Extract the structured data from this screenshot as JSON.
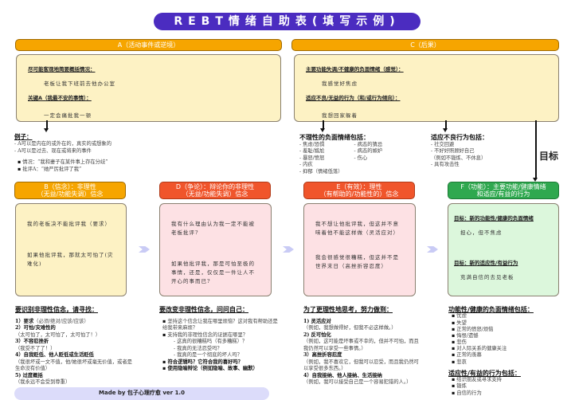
{
  "title": "REBT情绪自助表(填写示例)",
  "a": {
    "header": "A（活动事件或逆境）",
    "label1": "尽可能客观地简要概括情况：",
    "text1": "老板让我下班前去他办公室",
    "label2": "关键A（我最不安的事情）：",
    "text2": "一定会痛批我一顿",
    "example_title": "例子：",
    "example_lines": [
      "- A可以是内在的或外在的，真实的或想象的",
      "- A可以是过去、现在或将来的事件"
    ],
    "bullets": [
      "情况：“我和妻子在某件事上存在分歧”",
      "批评A：“她严厉批评了我”"
    ]
  },
  "c": {
    "header": "C（后果）",
    "label1": "主要功能失调/不健康的负面情绪（感觉）：",
    "text1": "我感觉好焦虑",
    "label2": "适应不良/无益的行为（和/或行为倾向）：",
    "text2": "我想回家躲着",
    "emotions_title": "不理性的负面情绪包括：",
    "emotions_col1": [
      "- 焦虑/恐惧",
      "- 羞耻/尴尬",
      "- 暴怒/愤怒",
      "- 内疚",
      "- 抑郁（情绪低落）"
    ],
    "emotions_col2": [
      "- 病态的猜忌",
      "- 病态的嫉妒",
      "- 伤心"
    ],
    "behaviors_title": "适应不良行为包括：",
    "behaviors": [
      "- 社交回避",
      "- 不好好照顾好自己",
      "（例如不锻炼、不休息）",
      "- 具有攻击性"
    ],
    "goal": "目标"
  },
  "b": {
    "header_line1": "B（信念）：非理性",
    "header_line2": "（无益/功能失调）信念",
    "text1": "我的老板决不能批评我（要求）",
    "text2": "如果他批评我，那就太可怕了(灾难化)",
    "guide_title": "要识别非理性信念，请寻找：",
    "guide": [
      {
        "t": "1）要求",
        "d": "（必须/绝对/应该/应该）"
      },
      {
        "t": "2）可怕/灾难性的",
        "d": "（太可怕了，太可怕了，太可怕了！）"
      },
      {
        "t": "3）不容忍挫折",
        "d": "（我受不了了！）"
      },
      {
        "t": "4）自我贬低、他人贬低或生活贬低",
        "d": "（我很坏或一文不值，他/她很坏或毫无价值，或者是生命没有价值）"
      },
      {
        "t": "5) 过度概括",
        "d": "（我永远不会受到尊重）"
      }
    ]
  },
  "d": {
    "header_line1": "D（争论）：辩论你的非理性",
    "header_line2": "（无益/功能失调）信念",
    "text1": "我有什么理由认为我一定不能被老板批评?",
    "text2": "如果他批评我，那是可怕至极的事情，还是，仅仅是一件让人不开心的事而已?",
    "guide_title": "要改变非理性信念，问问自己：",
    "guide": [
      "坚持这个信念让我在哪里烦恼？这对我有帮助还是给我带来麻烦？",
      "支持我的非理性信念的证据在哪里？",
      "- 这真的很糟糕吗（有多糟糕）？",
      "- 我真的无法忍受吗？",
      "- 我真的是一个彻底的坏人吗？",
      "符合逻辑吗？它符合我的喜好吗？",
      "使用隐喻辩论（例如隐喻、故事、幽默）"
    ]
  },
  "e": {
    "header_line1": "E（有效）：理性",
    "header_line2": "（有帮助的/功能性的）信念",
    "text1": "我不想让他批评我，但这并不意味着他不能这样做（灵活应对）",
    "text2": "我会很感觉很糟糕，但这并不是世界末日（高挫折容忍度）",
    "guide_title": "为了更理性地思考，努力做到：",
    "guide": [
      {
        "t": "1) 灵活应对",
        "d": "（例如，我想做得好，但我不必这样做。）"
      },
      {
        "t": "2) 反可怕化",
        "d": "（例如，这可能是坏事或不幸的，但并不可怕，而且我仍然可以享受一些事情。）"
      },
      {
        "t": "3）高挫折容忍度",
        "d": "（例如，我不喜欢它，但我可以忍受，而且我仍然可以享受很多东西。）"
      },
      {
        "t": "4）自我接纳、他人接纳、生活接纳",
        "d": "（例如，我可以接受自己是一个容易犯错的人。）"
      }
    ]
  },
  "f": {
    "header_line1": "F（功能）：主要功能/健康情绪",
    "header_line2": "和适应/有益的行为",
    "label1": "目标：新的功能性/健康的负面情绪",
    "text1": "担心，但不焦虑",
    "label2": "目标：新的适应性/有益行为",
    "text2": "充满自信的去见老板",
    "emotions_title": "功能性/健康的负面情绪包括：",
    "emotions": [
      "忧虑",
      "失望",
      "正常的愤怒/烦恼",
      "悔恨/遗憾",
      "悲伤",
      "对人际关系的健康关注",
      "正常的羡慕",
      "悲哀"
    ],
    "behaviors_title": "适应性/有益的行为包括：",
    "behaviors": [
      "结识朋友或寻求支持",
      "锻炼",
      "自信的行为"
    ]
  },
  "footer": "Made by 包子心理疗愈 ver 1.0"
}
